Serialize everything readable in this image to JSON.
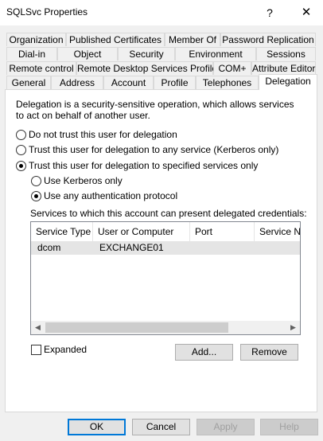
{
  "window": {
    "title": "SQLSvc Properties",
    "help_glyph": "?",
    "close_glyph": "✕"
  },
  "tabs": {
    "row1": [
      "Organization",
      "Published Certificates",
      "Member Of",
      "Password Replication"
    ],
    "row2": [
      "Dial-in",
      "Object",
      "Security",
      "Environment",
      "Sessions"
    ],
    "row3": [
      "Remote control",
      "Remote Desktop Services Profile",
      "COM+",
      "Attribute Editor"
    ],
    "row4": [
      "General",
      "Address",
      "Account",
      "Profile",
      "Telephones",
      "Delegation"
    ],
    "active": "Delegation"
  },
  "delegation": {
    "description": "Delegation is a security-sensitive operation, which allows services to act on behalf of another user.",
    "options": [
      {
        "label": "Do not trust this user for delegation",
        "checked": false
      },
      {
        "label": "Trust this user for delegation to any service (Kerberos only)",
        "checked": false
      },
      {
        "label": "Trust this user for delegation to specified services only",
        "checked": true
      }
    ],
    "sub_options": [
      {
        "label": "Use Kerberos only",
        "checked": false
      },
      {
        "label": "Use any authentication protocol",
        "checked": true
      }
    ],
    "services_label": "Services to which this account can present delegated credentials:",
    "columns": [
      "Service Type",
      "User or Computer",
      "Port",
      "Service Na"
    ],
    "rows": [
      {
        "service_type": "dcom",
        "user_or_computer": "EXCHANGE01",
        "port": "",
        "service_name": ""
      }
    ],
    "expanded_label": "Expanded",
    "expanded_checked": false,
    "add_label": "Add...",
    "remove_label": "Remove"
  },
  "footer": {
    "ok": "OK",
    "cancel": "Cancel",
    "apply": "Apply",
    "help": "Help"
  },
  "icons": {
    "scroll_left": "◀",
    "scroll_right": "▶"
  }
}
